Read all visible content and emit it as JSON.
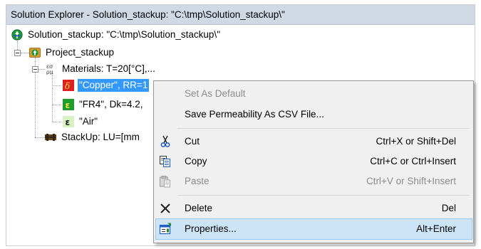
{
  "window": {
    "title": "Solution Explorer - Solution_stackup: \"C:\\tmp\\Solution_stackup\\\""
  },
  "tree": {
    "solution": {
      "label": "Solution_stackup: \"C:\\tmp\\Solution_stackup\\\""
    },
    "project": {
      "label": "Project_stackup"
    },
    "materials": {
      "label": "Materials: T=20[°C],..."
    },
    "copper": {
      "label": "\"Copper\", RR=1"
    },
    "fr4": {
      "label": "\"FR4\", Dk=4.2,"
    },
    "air": {
      "label": "\"Air\""
    },
    "stackup": {
      "label": "StackUp: LU=[mm"
    }
  },
  "context_menu": {
    "items": [
      {
        "label": "Set As Default",
        "shortcut": "",
        "icon": "",
        "enabled": false
      },
      {
        "label": "Save Permeability As CSV File...",
        "shortcut": "",
        "icon": "",
        "enabled": true
      },
      {
        "label": "Cut",
        "shortcut": "Ctrl+X or Shift+Del",
        "icon": "scissors-icon",
        "enabled": true
      },
      {
        "label": "Copy",
        "shortcut": "Ctrl+C or Ctrl+Insert",
        "icon": "copy-icon",
        "enabled": true
      },
      {
        "label": "Paste",
        "shortcut": "Ctrl+V or Shift+Insert",
        "icon": "paste-icon",
        "enabled": false
      },
      {
        "label": "Delete",
        "shortcut": "Del",
        "icon": "delete-x-icon",
        "enabled": true
      },
      {
        "label": "Properties...",
        "shortcut": "Alt+Enter",
        "icon": "properties-icon",
        "enabled": true,
        "highlighted": true
      }
    ]
  },
  "colors": {
    "title_bar": "#cfd8e3",
    "selection": "#3399ff",
    "menu_background": "#f0f0f0",
    "menu_highlight": "#cce4f7",
    "copper_icon": "#e02020",
    "dielectric_icon": "#1f9c2e"
  }
}
